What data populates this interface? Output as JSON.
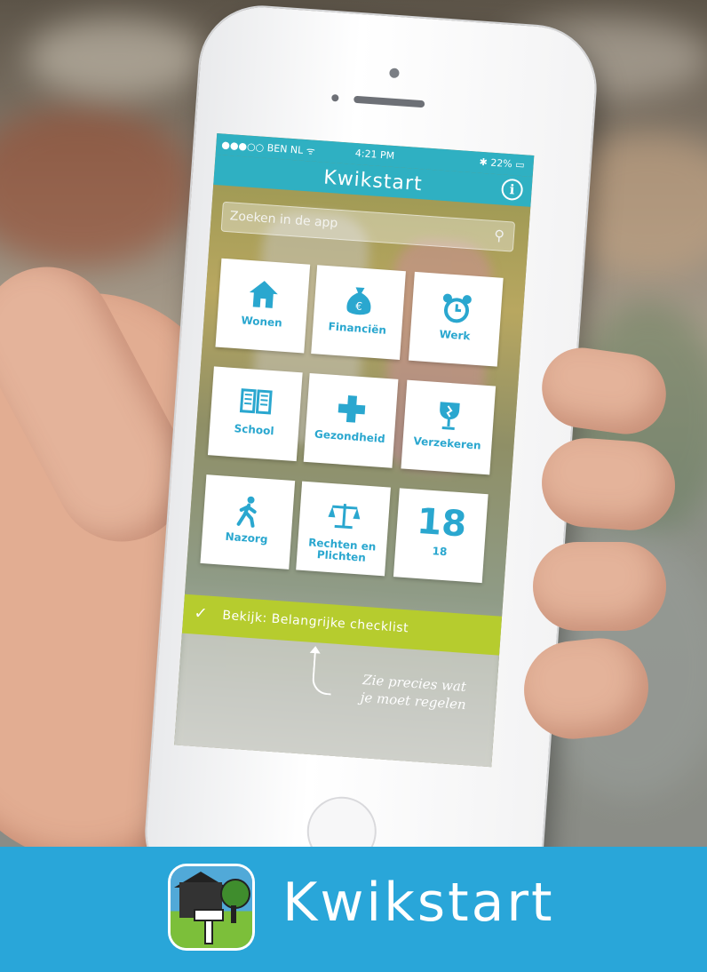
{
  "status_bar": {
    "carrier": "●●●○○ BEN NL ᯤ",
    "time": "4:21 PM",
    "battery": "✱ 22% ▭"
  },
  "nav": {
    "title": "Kwikstart",
    "info_symbol": "i"
  },
  "search": {
    "placeholder": "Zoeken in de app"
  },
  "tiles": [
    {
      "label": "Wonen",
      "icon": "house-icon"
    },
    {
      "label": "Financiën",
      "icon": "money-bag-icon"
    },
    {
      "label": "Werk",
      "icon": "alarm-clock-icon"
    },
    {
      "label": "School",
      "icon": "book-icon"
    },
    {
      "label": "Gezondheid",
      "icon": "cross-icon"
    },
    {
      "label": "Verzekeren",
      "icon": "broken-glass-icon"
    },
    {
      "label": "Nazorg",
      "icon": "walking-person-icon"
    },
    {
      "label": "Rechten en Plichten",
      "icon": "scales-icon"
    },
    {
      "label": "18",
      "big": "18",
      "icon": "number-18"
    }
  ],
  "checklist": {
    "label": "Bekijk: Belangrijke checklist"
  },
  "hint": {
    "line1": "Zie precies wat",
    "line2": "je moet regelen"
  },
  "brand": {
    "name": "Kwikstart"
  },
  "colors": {
    "accent": "#2fb0c2",
    "tile_icon": "#2aa7cf",
    "checklist_green": "#b6cc2e",
    "footer_blue": "#29a6d9"
  }
}
